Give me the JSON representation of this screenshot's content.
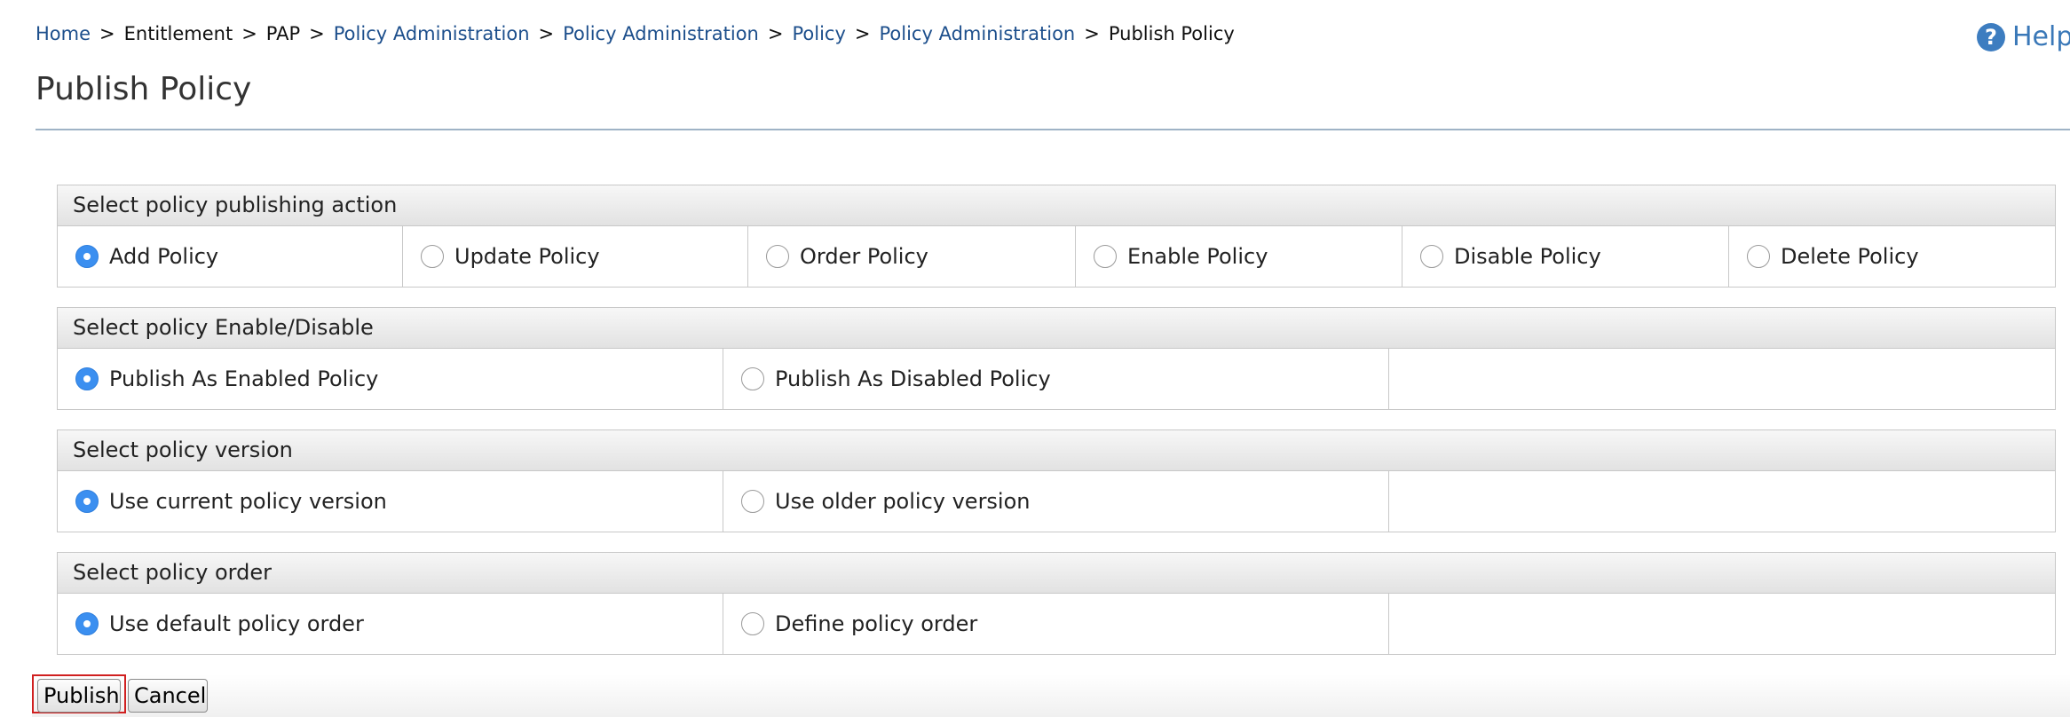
{
  "breadcrumb": {
    "items": [
      {
        "label": "Home",
        "link": true
      },
      {
        "label": "Entitlement",
        "link": false
      },
      {
        "label": "PAP",
        "link": false
      },
      {
        "label": "Policy Administration",
        "link": true
      },
      {
        "label": "Policy Administration",
        "link": true
      },
      {
        "label": "Policy",
        "link": true
      },
      {
        "label": "Policy Administration",
        "link": true
      },
      {
        "label": "Publish Policy",
        "link": false
      }
    ],
    "separator": ">"
  },
  "help": {
    "label": "Help",
    "icon": "question-circle-icon",
    "glyph": "?"
  },
  "page_title": "Publish Policy",
  "sections": {
    "action": {
      "header": "Select policy publishing action",
      "options": [
        "Add Policy",
        "Update Policy",
        "Order Policy",
        "Enable Policy",
        "Disable Policy",
        "Delete Policy"
      ],
      "selected": 0
    },
    "enable": {
      "header": "Select policy Enable/Disable",
      "options": [
        "Publish As Enabled Policy",
        "Publish As Disabled Policy"
      ],
      "selected": 0
    },
    "version": {
      "header": "Select policy version",
      "options": [
        "Use current policy version",
        "Use older policy version"
      ],
      "selected": 0
    },
    "order": {
      "header": "Select policy order",
      "options": [
        "Use default policy order",
        "Define policy order"
      ],
      "selected": 0
    }
  },
  "buttons": {
    "publish": "Publish",
    "cancel": "Cancel"
  },
  "colors": {
    "link": "#1d4f8c",
    "radio_checked": "#3b8ff0",
    "focus_outline": "#d02020"
  }
}
